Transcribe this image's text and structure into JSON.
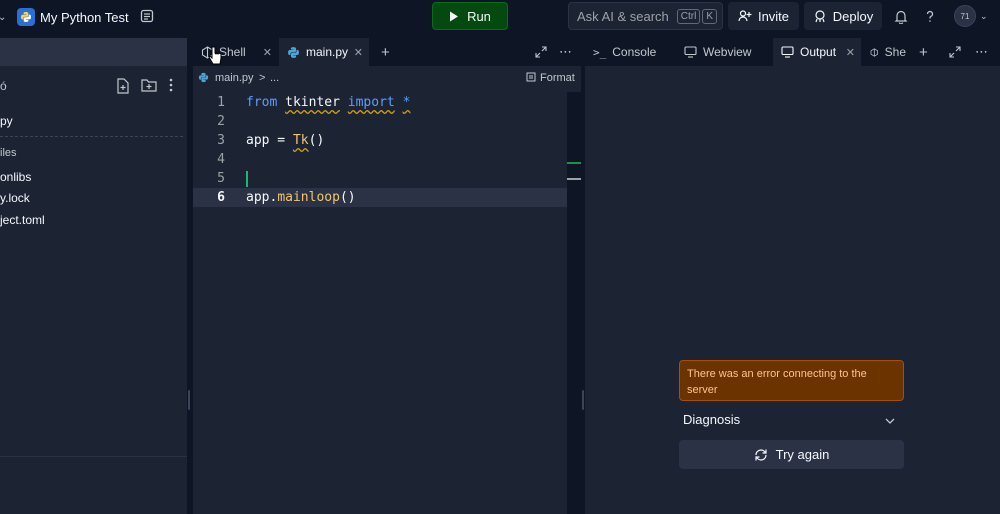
{
  "topbar": {
    "repl_title": "My Python Test",
    "run_label": "Run",
    "search_placeholder": "Ask AI & search",
    "kbd_ctrl": "Ctrl",
    "kbd_k": "K",
    "invite_label": "Invite",
    "deploy_label": "Deploy",
    "avatar_initials": "71",
    "run_color": "#044a10"
  },
  "sidebar": {
    "files_header_fragment": "ó",
    "items": [
      {
        "label": "py"
      },
      {
        "label": "iles"
      },
      {
        "label": "onlibs"
      },
      {
        "label": "y.lock"
      },
      {
        "label": "ject.toml"
      }
    ]
  },
  "editor": {
    "tabs": [
      {
        "label": "Shell",
        "icon": "shell-icon"
      },
      {
        "label": "main.py",
        "icon": "python-icon"
      }
    ],
    "breadcrumb": {
      "file": "main.py",
      "sep": ">",
      "more": "...",
      "format": "Format"
    },
    "lines": [
      {
        "num": "1"
      },
      {
        "num": "2"
      },
      {
        "num": "3"
      },
      {
        "num": "4"
      },
      {
        "num": "5"
      },
      {
        "num": "6"
      }
    ],
    "code": {
      "l1_from": "from",
      "l1_mod": "tkinter",
      "l1_import": "import",
      "l1_star": "*",
      "l3_app": "app = ",
      "l3_tk": "Tk",
      "l3_paren": "()",
      "l6_app": "app.",
      "l6_main": "mainloop",
      "l6_paren": "()"
    }
  },
  "right_panel": {
    "tabs": [
      {
        "label": "Console"
      },
      {
        "label": "Webview"
      },
      {
        "label": "Output"
      },
      {
        "label": "She"
      }
    ],
    "error_message": "There was an error connecting to the server",
    "diagnosis_label": "Diagnosis",
    "try_again_label": "Try again"
  }
}
